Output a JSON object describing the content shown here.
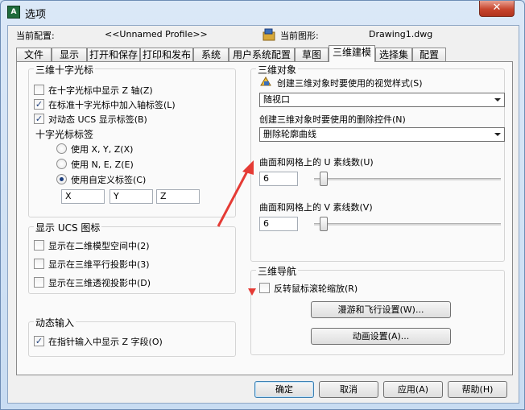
{
  "window": {
    "title": "选项",
    "app_icon_text": "A",
    "close_symbol": "✕"
  },
  "config": {
    "current_profile_label": "当前配置:",
    "current_profile_value": "<<Unnamed Profile>>",
    "current_drawing_label": "当前图形:",
    "current_drawing_value": "Drawing1.dwg"
  },
  "tabs": [
    "文件",
    "显示",
    "打开和保存",
    "打印和发布",
    "系统",
    "用户系统配置",
    "草图",
    "三维建模",
    "选择集",
    "配置"
  ],
  "crosshair": {
    "title": "三维十字光标",
    "items": [
      {
        "label": "在十字光标中显示 Z 轴(Z)",
        "checked": false
      },
      {
        "label": "在标准十字光标中加入轴标签(L)",
        "checked": true
      },
      {
        "label": "对动态 UCS 显示标签(B)",
        "checked": true
      }
    ],
    "labels_title": "十字光标标签",
    "radios": [
      {
        "label": "使用 X, Y, Z(X)",
        "selected": false
      },
      {
        "label": "使用 N, E, Z(E)",
        "selected": false
      },
      {
        "label": "使用自定义标签(C)",
        "selected": true
      }
    ],
    "custom_labels": [
      "X",
      "Y",
      "Z"
    ]
  },
  "ucs": {
    "title": "显示 UCS 图标",
    "items": [
      {
        "label": "显示在二维模型空间中(2)",
        "checked": false
      },
      {
        "label": "显示在三维平行投影中(3)",
        "checked": false
      },
      {
        "label": "显示在三维透视投影中(D)",
        "checked": false
      }
    ]
  },
  "dynamic": {
    "title": "动态输入",
    "item": {
      "label": "在指针输入中显示 Z 字段(O)",
      "checked": true
    }
  },
  "objects3d": {
    "title": "三维对象",
    "visual_style_label": "创建三维对象时要使用的视觉样式(S)",
    "visual_style_value": "随视口",
    "deletion_label": "创建三维对象时要使用的删除控件(N)",
    "deletion_value": "删除轮廓曲线",
    "u_label": "曲面和网格上的 U 素线数(U)",
    "u_value": "6",
    "v_label": "曲面和网格上的 V 素线数(V)",
    "v_value": "6"
  },
  "nav3d": {
    "title": "三维导航",
    "reverse_wheel": {
      "label": "反转鼠标滚轮缩放(R)",
      "checked": false
    },
    "walkfly_button": "漫游和飞行设置(W)...",
    "animation_button": "动画设置(A)..."
  },
  "footer": {
    "ok": "确定",
    "cancel": "取消",
    "apply": "应用(A)",
    "help": "帮助(H)"
  },
  "colors": {
    "annotation": "#e53b35",
    "accent": "#3c7fb1"
  }
}
